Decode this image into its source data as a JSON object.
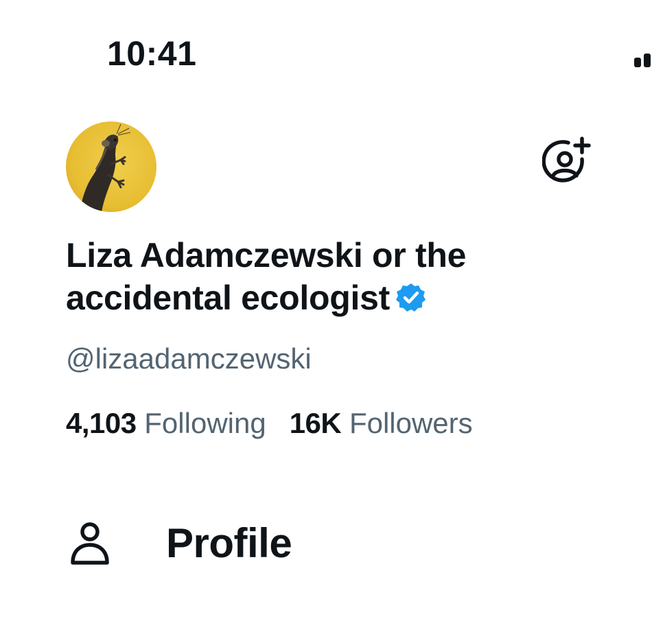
{
  "status_bar": {
    "time": "10:41"
  },
  "profile": {
    "avatar_icon": "rat-illustration-avatar",
    "display_name": "Liza Adamczewski or the accidental ecologist",
    "verified": true,
    "verified_color": "#1d9bf0",
    "handle": "@lizaadamczewski",
    "following_count": "4,103",
    "following_label": "Following",
    "followers_count": "16K",
    "followers_label": "Followers"
  },
  "header": {
    "add_account_icon": "add-account-icon"
  },
  "menu": {
    "items": [
      {
        "label": "Profile",
        "icon": "person-icon"
      }
    ]
  },
  "colors": {
    "text_primary": "#0f1419",
    "text_secondary": "#536471",
    "avatar_background": "#e8c23a"
  }
}
